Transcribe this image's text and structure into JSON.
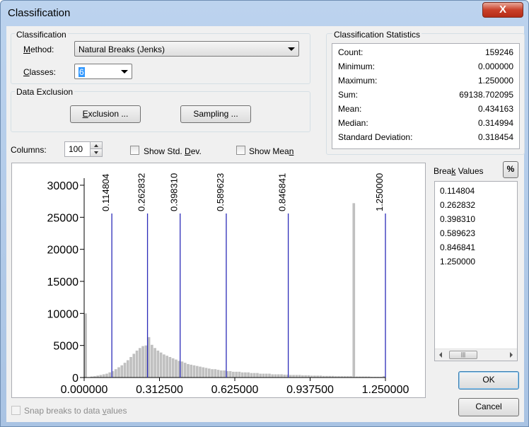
{
  "window": {
    "title": "Classification",
    "close_label": "X"
  },
  "classification": {
    "group_label": "Classification",
    "method_label_pre": "",
    "method_label_u": "M",
    "method_label_post": "ethod:",
    "method_value": "Natural Breaks (Jenks)",
    "classes_label_u": "C",
    "classes_label_post": "lasses:",
    "classes_value": "6"
  },
  "data_exclusion": {
    "group_label": "Data Exclusion",
    "exclusion_button_u": "E",
    "exclusion_button_post": "xclusion ...",
    "sampling_button": "Sampling ..."
  },
  "statistics": {
    "group_label": "Classification Statistics",
    "rows": [
      {
        "key": "Count:",
        "value": "159246"
      },
      {
        "key": "Minimum:",
        "value": "0.000000"
      },
      {
        "key": "Maximum:",
        "value": "1.250000"
      },
      {
        "key": "Sum:",
        "value": "69138.702095"
      },
      {
        "key": "Mean:",
        "value": "0.434163"
      },
      {
        "key": "Median:",
        "value": "0.314994"
      },
      {
        "key": "Standard Deviation:",
        "value": "0.318454"
      }
    ]
  },
  "controls": {
    "columns_label": "Columns:",
    "columns_value": "100",
    "show_std_dev_pre": "Show Std. ",
    "show_std_dev_u": "D",
    "show_std_dev_post": "ev.",
    "show_mean_pre": "Show Mea",
    "show_mean_u": "n",
    "show_mean_post": ""
  },
  "breaks_panel": {
    "label_pre": "Brea",
    "label_u": "k",
    "label_post": " Values",
    "percent_button": "%",
    "values": [
      "0.114804",
      "0.262832",
      "0.398310",
      "0.589623",
      "0.846841",
      "1.250000"
    ]
  },
  "buttons": {
    "ok": "OK",
    "cancel": "Cancel"
  },
  "snap": {
    "label_pre": "Snap breaks to data ",
    "label_u": "v",
    "label_post": "alues"
  },
  "colors": {
    "bar": "#c0c0c0",
    "break_line": "#2b2bb8"
  },
  "chart_data": {
    "type": "bar",
    "xlim": [
      0,
      1.25
    ],
    "ylim": [
      0,
      30000
    ],
    "x_ticks": [
      "0.000000",
      "0.312500",
      "0.625000",
      "0.937500",
      "1.250000"
    ],
    "x_tick_values": [
      0,
      0.3125,
      0.625,
      0.9375,
      1.25
    ],
    "y_ticks": [
      "0",
      "5000",
      "10000",
      "15000",
      "20000",
      "25000",
      "30000"
    ],
    "y_tick_values": [
      0,
      5000,
      10000,
      15000,
      20000,
      25000,
      30000
    ],
    "bins": 100,
    "bin_width": 0.0125,
    "values": [
      10000,
      0,
      150,
      200,
      300,
      400,
      500,
      600,
      800,
      1000,
      1300,
      1600,
      1900,
      2300,
      2700,
      3200,
      3700,
      4200,
      4600,
      4900,
      5000,
      6300,
      5100,
      4600,
      4200,
      3900,
      3600,
      3400,
      3200,
      3000,
      2800,
      2600,
      2500,
      2300,
      2100,
      2000,
      1900,
      1800,
      1700,
      1600,
      1500,
      1400,
      1300,
      1300,
      1200,
      1100,
      1100,
      1000,
      1000,
      900,
      900,
      900,
      800,
      800,
      800,
      700,
      700,
      700,
      600,
      600,
      600,
      600,
      500,
      500,
      500,
      500,
      450,
      450,
      400,
      400,
      400,
      400,
      350,
      350,
      350,
      300,
      300,
      300,
      300,
      250,
      250,
      250,
      250,
      200,
      200,
      200,
      200,
      200,
      200,
      27200,
      150,
      150,
      150,
      150,
      150,
      100,
      100,
      100,
      100,
      200
    ],
    "breaks": [
      0.114804,
      0.262832,
      0.39831,
      0.589623,
      0.846841,
      1.25
    ],
    "break_labels": [
      "0.114804",
      "0.262832",
      "0.398310",
      "0.589623",
      "0.846841",
      "1.250000"
    ]
  }
}
